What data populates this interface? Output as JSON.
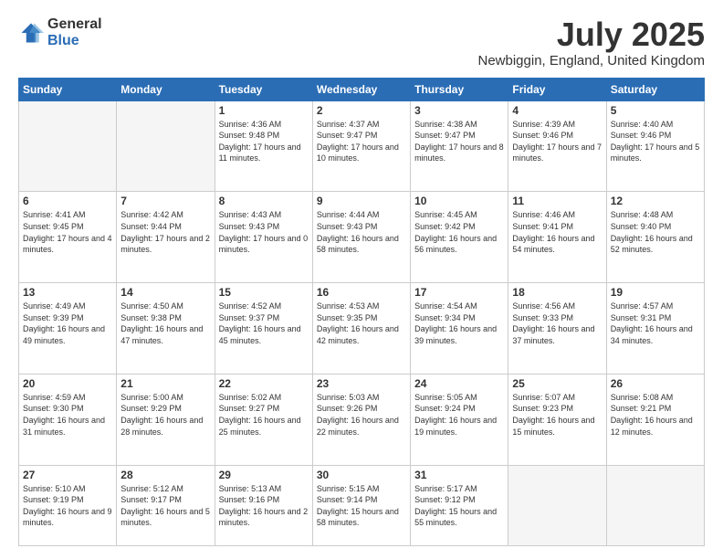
{
  "logo": {
    "general": "General",
    "blue": "Blue"
  },
  "header": {
    "title": "July 2025",
    "subtitle": "Newbiggin, England, United Kingdom"
  },
  "weekdays": [
    "Sunday",
    "Monday",
    "Tuesday",
    "Wednesday",
    "Thursday",
    "Friday",
    "Saturday"
  ],
  "weeks": [
    [
      {
        "day": "",
        "info": ""
      },
      {
        "day": "",
        "info": ""
      },
      {
        "day": "1",
        "info": "Sunrise: 4:36 AM\nSunset: 9:48 PM\nDaylight: 17 hours and 11 minutes."
      },
      {
        "day": "2",
        "info": "Sunrise: 4:37 AM\nSunset: 9:47 PM\nDaylight: 17 hours and 10 minutes."
      },
      {
        "day": "3",
        "info": "Sunrise: 4:38 AM\nSunset: 9:47 PM\nDaylight: 17 hours and 8 minutes."
      },
      {
        "day": "4",
        "info": "Sunrise: 4:39 AM\nSunset: 9:46 PM\nDaylight: 17 hours and 7 minutes."
      },
      {
        "day": "5",
        "info": "Sunrise: 4:40 AM\nSunset: 9:46 PM\nDaylight: 17 hours and 5 minutes."
      }
    ],
    [
      {
        "day": "6",
        "info": "Sunrise: 4:41 AM\nSunset: 9:45 PM\nDaylight: 17 hours and 4 minutes."
      },
      {
        "day": "7",
        "info": "Sunrise: 4:42 AM\nSunset: 9:44 PM\nDaylight: 17 hours and 2 minutes."
      },
      {
        "day": "8",
        "info": "Sunrise: 4:43 AM\nSunset: 9:43 PM\nDaylight: 17 hours and 0 minutes."
      },
      {
        "day": "9",
        "info": "Sunrise: 4:44 AM\nSunset: 9:43 PM\nDaylight: 16 hours and 58 minutes."
      },
      {
        "day": "10",
        "info": "Sunrise: 4:45 AM\nSunset: 9:42 PM\nDaylight: 16 hours and 56 minutes."
      },
      {
        "day": "11",
        "info": "Sunrise: 4:46 AM\nSunset: 9:41 PM\nDaylight: 16 hours and 54 minutes."
      },
      {
        "day": "12",
        "info": "Sunrise: 4:48 AM\nSunset: 9:40 PM\nDaylight: 16 hours and 52 minutes."
      }
    ],
    [
      {
        "day": "13",
        "info": "Sunrise: 4:49 AM\nSunset: 9:39 PM\nDaylight: 16 hours and 49 minutes."
      },
      {
        "day": "14",
        "info": "Sunrise: 4:50 AM\nSunset: 9:38 PM\nDaylight: 16 hours and 47 minutes."
      },
      {
        "day": "15",
        "info": "Sunrise: 4:52 AM\nSunset: 9:37 PM\nDaylight: 16 hours and 45 minutes."
      },
      {
        "day": "16",
        "info": "Sunrise: 4:53 AM\nSunset: 9:35 PM\nDaylight: 16 hours and 42 minutes."
      },
      {
        "day": "17",
        "info": "Sunrise: 4:54 AM\nSunset: 9:34 PM\nDaylight: 16 hours and 39 minutes."
      },
      {
        "day": "18",
        "info": "Sunrise: 4:56 AM\nSunset: 9:33 PM\nDaylight: 16 hours and 37 minutes."
      },
      {
        "day": "19",
        "info": "Sunrise: 4:57 AM\nSunset: 9:31 PM\nDaylight: 16 hours and 34 minutes."
      }
    ],
    [
      {
        "day": "20",
        "info": "Sunrise: 4:59 AM\nSunset: 9:30 PM\nDaylight: 16 hours and 31 minutes."
      },
      {
        "day": "21",
        "info": "Sunrise: 5:00 AM\nSunset: 9:29 PM\nDaylight: 16 hours and 28 minutes."
      },
      {
        "day": "22",
        "info": "Sunrise: 5:02 AM\nSunset: 9:27 PM\nDaylight: 16 hours and 25 minutes."
      },
      {
        "day": "23",
        "info": "Sunrise: 5:03 AM\nSunset: 9:26 PM\nDaylight: 16 hours and 22 minutes."
      },
      {
        "day": "24",
        "info": "Sunrise: 5:05 AM\nSunset: 9:24 PM\nDaylight: 16 hours and 19 minutes."
      },
      {
        "day": "25",
        "info": "Sunrise: 5:07 AM\nSunset: 9:23 PM\nDaylight: 16 hours and 15 minutes."
      },
      {
        "day": "26",
        "info": "Sunrise: 5:08 AM\nSunset: 9:21 PM\nDaylight: 16 hours and 12 minutes."
      }
    ],
    [
      {
        "day": "27",
        "info": "Sunrise: 5:10 AM\nSunset: 9:19 PM\nDaylight: 16 hours and 9 minutes."
      },
      {
        "day": "28",
        "info": "Sunrise: 5:12 AM\nSunset: 9:17 PM\nDaylight: 16 hours and 5 minutes."
      },
      {
        "day": "29",
        "info": "Sunrise: 5:13 AM\nSunset: 9:16 PM\nDaylight: 16 hours and 2 minutes."
      },
      {
        "day": "30",
        "info": "Sunrise: 5:15 AM\nSunset: 9:14 PM\nDaylight: 15 hours and 58 minutes."
      },
      {
        "day": "31",
        "info": "Sunrise: 5:17 AM\nSunset: 9:12 PM\nDaylight: 15 hours and 55 minutes."
      },
      {
        "day": "",
        "info": ""
      },
      {
        "day": "",
        "info": ""
      }
    ]
  ]
}
